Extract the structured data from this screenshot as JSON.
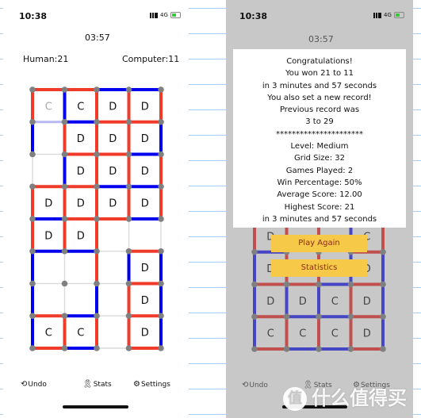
{
  "colors": {
    "human_red": "#f03a2a",
    "computer_blue": "#0000ee",
    "dim_red": "#c0504d",
    "dim_blue": "#4646c4",
    "dot": "#808080",
    "button": "#f7c948",
    "button_text": "#8b2a1a"
  },
  "left": {
    "status_time": "10:38",
    "network": "4G",
    "timer": "03:57",
    "human_score": "Human:21",
    "computer_score": "Computer:11",
    "grid": {
      "h": [
        [
          "r",
          "r",
          "b",
          "b"
        ],
        [
          "l",
          "b",
          "r",
          "r"
        ],
        [
          "n",
          "r",
          "r",
          "b"
        ],
        [
          "r",
          "r",
          "b",
          "b"
        ],
        [
          "b",
          "r",
          "r",
          "b"
        ],
        [
          "b",
          "b",
          "n",
          "r"
        ],
        [
          "n",
          "n",
          "n",
          "r"
        ],
        [
          "r",
          "b",
          "n",
          "r"
        ],
        [
          "r",
          "b",
          "n",
          "r"
        ]
      ],
      "v": [
        [
          "r",
          "b",
          "r",
          "r",
          "r"
        ],
        [
          "b",
          "r",
          "r",
          "r",
          "b"
        ],
        [
          "n",
          "b",
          "r",
          "r",
          "r"
        ],
        [
          "r",
          "r",
          "r",
          "r",
          "r"
        ],
        [
          "r",
          "r",
          "r",
          "n",
          "n"
        ],
        [
          "b",
          "n",
          "r",
          "b",
          "b"
        ],
        [
          "b",
          "n",
          "b",
          "r",
          "b"
        ],
        [
          "b",
          "r",
          "r",
          "r",
          "b"
        ]
      ],
      "boxes": [
        [
          "c",
          "C",
          "D",
          "D"
        ],
        [
          "",
          "D",
          "D",
          "D"
        ],
        [
          "",
          "D",
          "D",
          "D"
        ],
        [
          "D",
          "D",
          "D",
          "D"
        ],
        [
          "D",
          "D",
          "",
          ""
        ],
        [
          "",
          "",
          "",
          "D"
        ],
        [
          "",
          "",
          "",
          "D"
        ],
        [
          "C",
          "C",
          "",
          "D"
        ]
      ]
    },
    "nav": {
      "undo": "Undo",
      "stats": "Stats",
      "settings": "Settings"
    }
  },
  "right": {
    "status_time": "10:38",
    "network": "4G",
    "timer": "03:57",
    "grid_visible": {
      "h": [
        [
          "?",
          "?",
          "?",
          "?"
        ],
        [
          "b",
          "?",
          "?",
          "r"
        ],
        [
          "r",
          "r",
          "b",
          "r"
        ],
        [
          "r",
          "b",
          "b",
          "r"
        ],
        [
          "r",
          "b",
          "b",
          "r"
        ]
      ],
      "v": [
        [
          "r",
          "r",
          "r",
          "b",
          "r"
        ],
        [
          "b",
          "r",
          "r",
          "b",
          "b"
        ],
        [
          "b",
          "b",
          "b",
          "r",
          "b"
        ],
        [
          "b",
          "r",
          "r",
          "r",
          "b"
        ]
      ],
      "boxes": [
        [
          "D",
          "",
          "",
          "C"
        ],
        [
          "D",
          "",
          "",
          "D"
        ],
        [
          "D",
          "D",
          "C",
          "D"
        ],
        [
          "C",
          "C",
          "C",
          "D"
        ]
      ]
    },
    "dialog": {
      "lines": [
        "Congratulations!",
        "You won 21 to 11",
        "in 3 minutes and 57 seconds",
        "You also set a new record!",
        "Previous record was",
        "3 to 29",
        "**********************",
        "Level: Medium",
        "Grid Size: 32",
        "Games Played: 2",
        "Win Percentage: 50%",
        "Average Score: 12.00",
        "Highest Score: 21",
        "in 3 minutes and 57 seconds"
      ]
    },
    "play_again": "Play Again",
    "statistics": "Statistics",
    "nav": {
      "undo": "Undo",
      "stats": "Stats",
      "settings": "Settings"
    }
  },
  "watermark": {
    "logo_char": "值",
    "text": "什么值得买"
  },
  "icons": {
    "undo": "undo-circle-icon",
    "stats": "award-ribbon-icon",
    "settings": "gear-play-icon"
  }
}
